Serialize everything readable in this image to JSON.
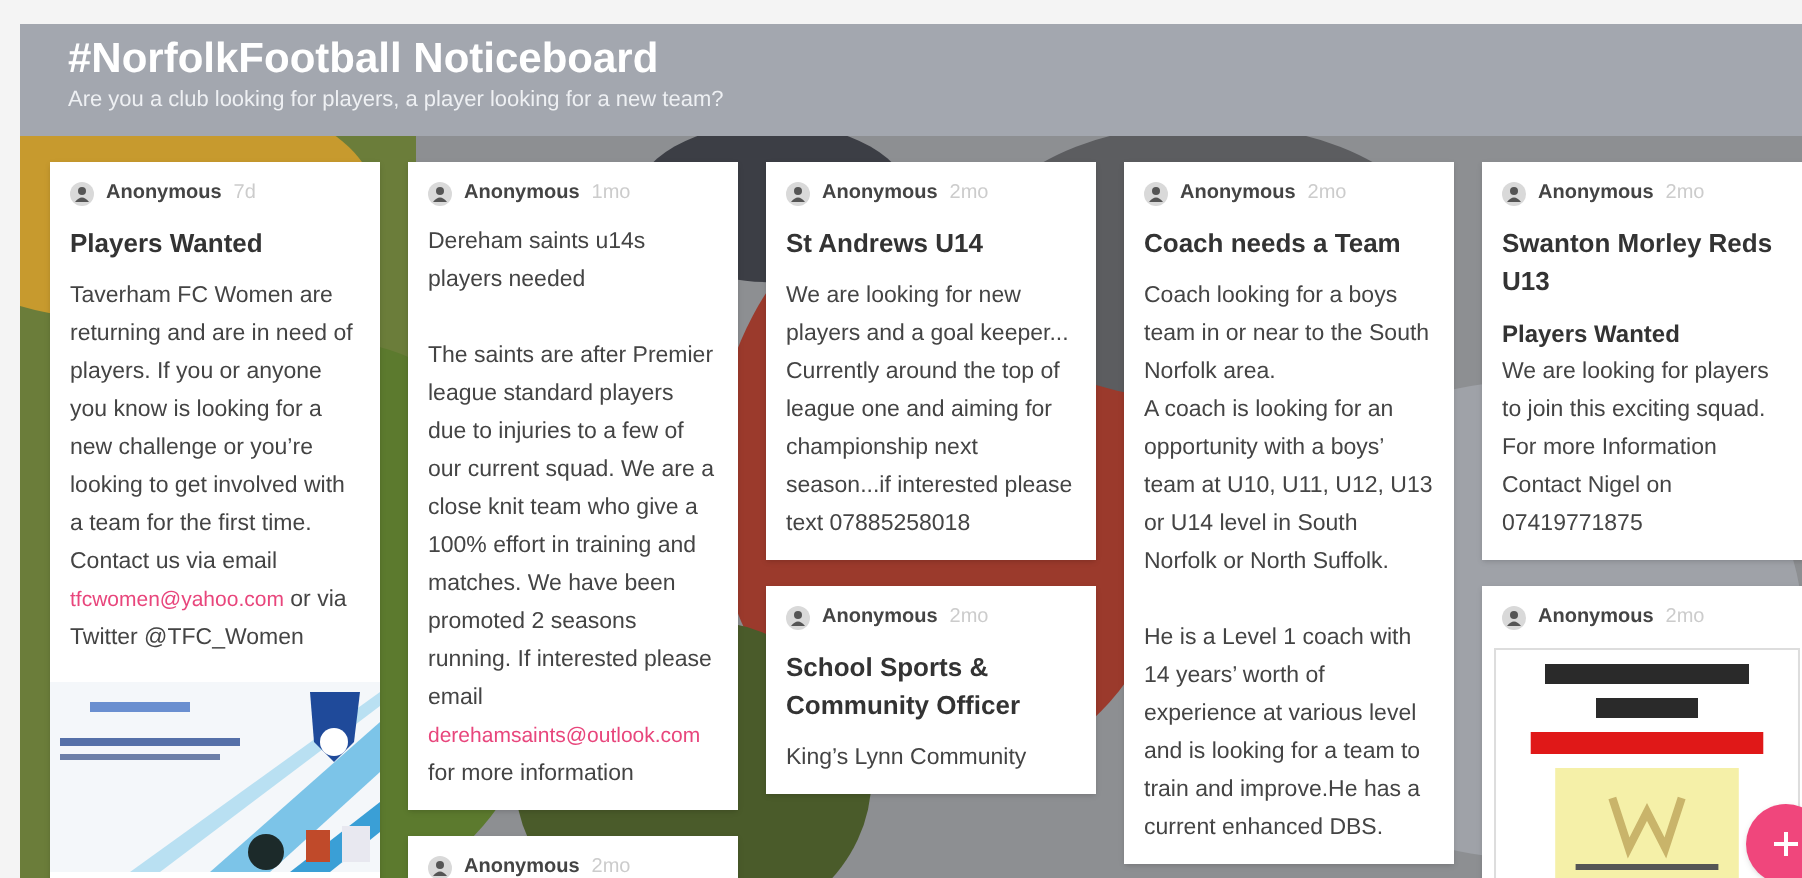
{
  "board": {
    "title": "#NorfolkFootball Noticeboard",
    "subtitle": "Are you a club looking for players, a player looking for a new team?"
  },
  "columns": [
    {
      "posts": [
        {
          "author": "Anonymous",
          "age": "7d",
          "title": "Players Wanted",
          "content": [
            {
              "kind": "paragraph",
              "parts": [
                {
                  "kind": "text",
                  "text": "Taverham FC Women are returning and are in need of players. If you or anyone you know is looking for a new challenge or you’re looking to get involved with a team for the first time. Contact us via email "
                },
                {
                  "kind": "link",
                  "text": "tfcwomen@yahoo.com"
                },
                {
                  "kind": "text",
                  "text": " or via Twitter @TFC_Women"
                }
              ]
            },
            {
              "kind": "picture"
            }
          ]
        }
      ]
    },
    {
      "posts": [
        {
          "author": "Anonymous",
          "age": "1mo",
          "content": [
            {
              "kind": "paragraph",
              "parts": [
                {
                  "kind": "text",
                  "text": "Dereham saints u14s players needed"
                }
              ]
            },
            {
              "kind": "paragraph",
              "parts": [
                {
                  "kind": "text",
                  "text": "The saints are after Premier league standard players due to injuries to a few of our current squad. We are a close knit team who give a 100% effort in training and matches. We have been promoted 2 seasons running.  If interested please email "
                },
                {
                  "kind": "link",
                  "text": "derehamsaints@outlook.com"
                },
                {
                  "kind": "text",
                  "text": " for more information"
                }
              ]
            }
          ]
        },
        {
          "author": "Anonymous",
          "age": "2mo"
        }
      ]
    },
    {
      "posts": [
        {
          "author": "Anonymous",
          "age": "2mo",
          "title": "St Andrews U14",
          "content": [
            {
              "kind": "paragraph",
              "parts": [
                {
                  "kind": "text",
                  "text": "We are looking for new players and a goal keeper... Currently around the top of league one and aiming for championship next season...if interested please text 07885258018"
                }
              ]
            }
          ]
        },
        {
          "author": "Anonymous",
          "age": "2mo",
          "title": "School Sports & Community Officer",
          "content": [
            {
              "kind": "paragraph",
              "parts": [
                {
                  "kind": "text",
                  "text": "King’s Lynn Community"
                }
              ]
            }
          ]
        }
      ]
    },
    {
      "posts": [
        {
          "author": "Anonymous",
          "age": "2mo",
          "title": "Coach needs a Team",
          "content": [
            {
              "kind": "paragraph",
              "parts": [
                {
                  "kind": "text",
                  "text": "Coach looking for a boys team in or near to the South Norfolk area."
                }
              ]
            },
            {
              "kind": "line",
              "parts": [
                {
                  "kind": "text",
                  "text": "A coach is looking for an opportunity with a boys’ team at U10, U11, U12, U13 or U14 level in South Norfolk or North Suffolk."
                }
              ]
            },
            {
              "kind": "paragraph",
              "parts": [
                {
                  "kind": "text",
                  "text": "He is a Level 1 coach with 14 years’ worth of experience at various level and is looking for a team to train and improve.He has a current enhanced DBS."
                }
              ]
            }
          ]
        }
      ]
    },
    {
      "posts": [
        {
          "author": "Anonymous",
          "age": "2mo",
          "title": "Swanton Morley Reds U13",
          "content": [
            {
              "kind": "subheading",
              "text": "Players Wanted"
            },
            {
              "kind": "line",
              "parts": [
                {
                  "kind": "text",
                  "text": "We are looking for players to join this exciting squad. For more Information Contact Nigel on 07419771875"
                }
              ]
            }
          ]
        },
        {
          "author": "Anonymous",
          "age": "2mo",
          "content": [
            {
              "kind": "picture"
            }
          ]
        }
      ]
    }
  ]
}
